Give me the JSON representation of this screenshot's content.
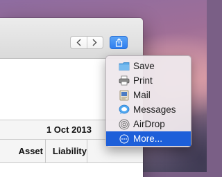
{
  "window": {
    "nav": {
      "back_icon": "chevron-left-icon",
      "forward_icon": "chevron-right-icon"
    },
    "share_icon": "share-icon"
  },
  "table": {
    "date": "1 Oct 2013",
    "columns": [
      "Asset",
      "Liability"
    ]
  },
  "share_menu": {
    "items": [
      {
        "label": "Save",
        "icon": "folder-icon"
      },
      {
        "label": "Print",
        "icon": "printer-icon"
      },
      {
        "label": "Mail",
        "icon": "mail-icon"
      },
      {
        "label": "Messages",
        "icon": "messages-icon"
      },
      {
        "label": "AirDrop",
        "icon": "airdrop-icon"
      },
      {
        "label": "More...",
        "icon": "more-icon",
        "selected": true
      }
    ]
  },
  "colors": {
    "accent": "#1d5fd9",
    "share_button": "#3a86f1"
  }
}
